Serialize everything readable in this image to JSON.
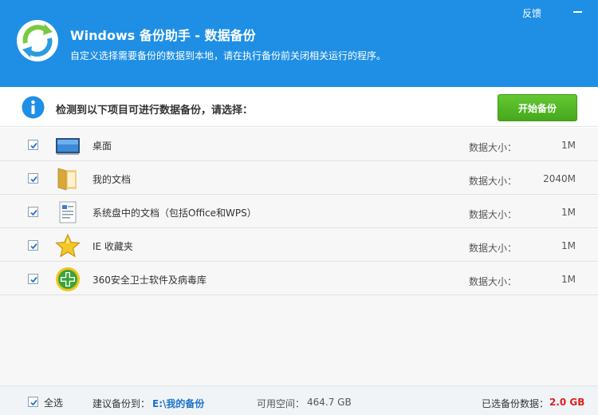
{
  "window": {
    "title": "Windows 备份助手 - 数据备份",
    "subtitle": "自定义选择需要备份的数据到本地，请在执行备份前关闭相关运行的程序。",
    "feedback_label": "反馈",
    "minimize_icon": "minimize-icon",
    "logo_icon": "backup-sync-icon",
    "accent_color": "#1f8fe6"
  },
  "prompt": {
    "text": "检测到以下项目可进行数据备份，请选择：",
    "info_icon": "info-icon",
    "start_button_label": "开始备份",
    "start_button_color": "#52b526"
  },
  "items": [
    {
      "name": "桌面",
      "icon": "desktop-icon",
      "checked": true,
      "size_label": "数据大小：",
      "size": "1M"
    },
    {
      "name": "我的文档",
      "icon": "documents-folder-icon",
      "checked": true,
      "size_label": "数据大小：",
      "size": "2040M"
    },
    {
      "name": "系统盘中的文档（包括Office和WPS）",
      "icon": "office-document-icon",
      "checked": true,
      "size_label": "数据大小：",
      "size": "1M"
    },
    {
      "name": "IE 收藏夹",
      "icon": "favorites-star-icon",
      "checked": true,
      "size_label": "数据大小：",
      "size": "1M"
    },
    {
      "name": "360安全卫士软件及病毒库",
      "icon": "360-security-icon",
      "checked": true,
      "size_label": "数据大小：",
      "size": "1M"
    }
  ],
  "footer": {
    "select_all_label": "全选",
    "select_all_checked": true,
    "suggest_label": "建议备份到：",
    "suggest_path": "E:\\我的备份",
    "space_label": "可用空间：",
    "space_value": "464.7 GB",
    "selected_label": "已选备份数据：",
    "selected_value": "2.0 GB",
    "selected_value_color": "#e02020"
  }
}
